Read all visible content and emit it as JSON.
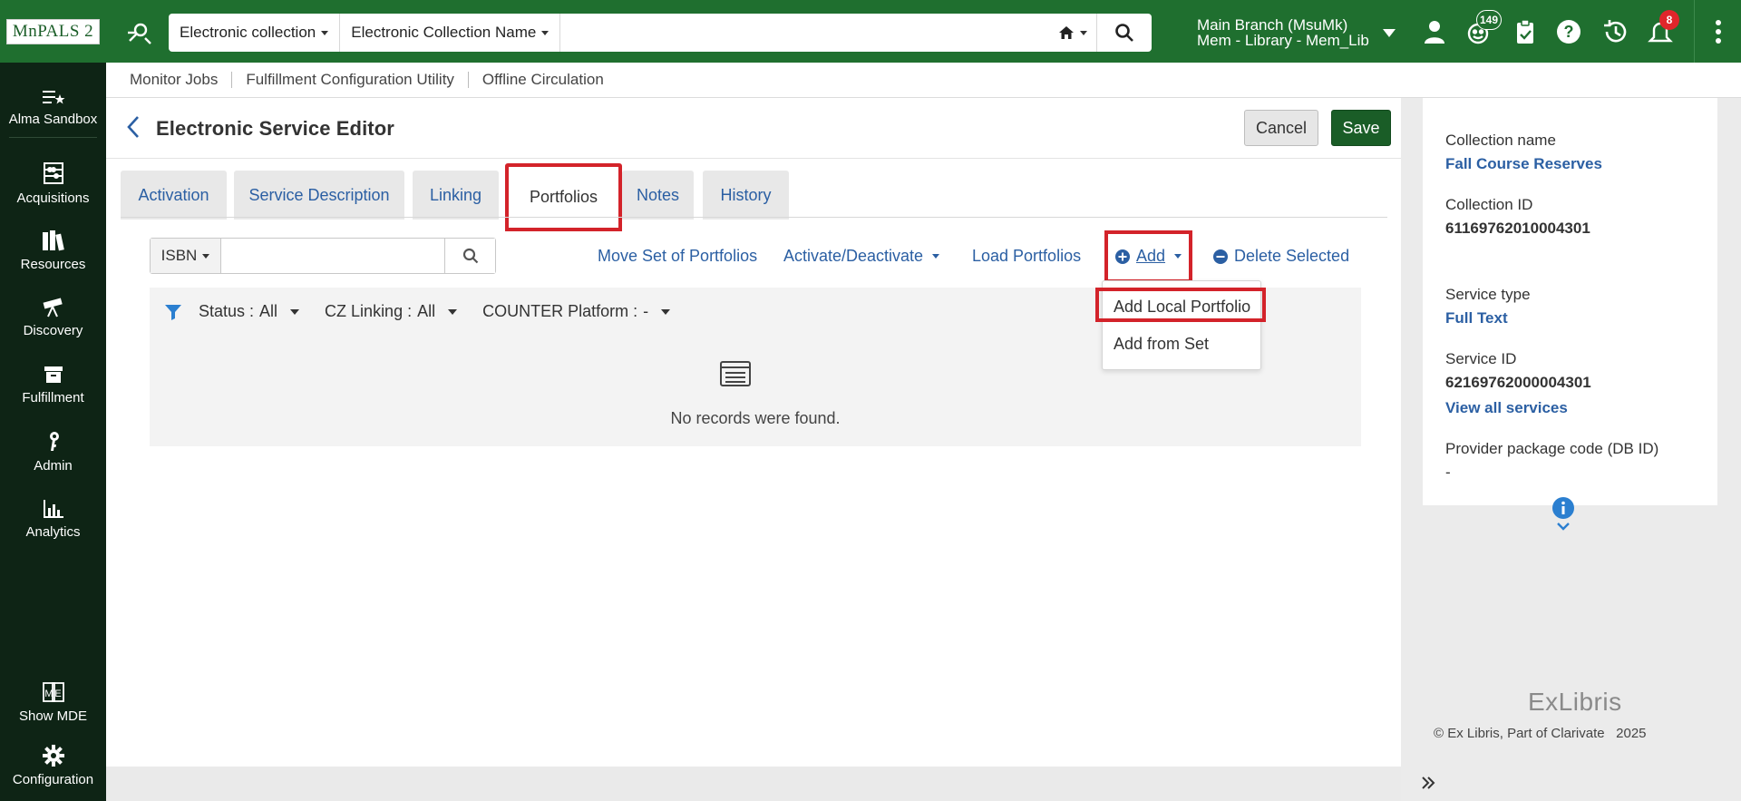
{
  "topbar": {
    "logo": "MnPALS 2",
    "search": {
      "scope": "Electronic collection",
      "field": "Electronic Collection Name",
      "placeholder": ""
    },
    "branch_line1": "Main Branch (MsuMk)",
    "branch_line2": "Mem - Library - Mem_Lib",
    "tasks_badge": "149",
    "notifications_badge": "8"
  },
  "leftnav": {
    "items": [
      {
        "label": "Alma Sandbox",
        "icon": "list-star-icon"
      },
      {
        "label": "Acquisitions",
        "icon": "abacus-icon"
      },
      {
        "label": "Resources",
        "icon": "books-icon"
      },
      {
        "label": "Discovery",
        "icon": "telescope-icon"
      },
      {
        "label": "Fulfillment",
        "icon": "archive-box-icon"
      },
      {
        "label": "Admin",
        "icon": "key-icon"
      },
      {
        "label": "Analytics",
        "icon": "bar-chart-icon"
      },
      {
        "label": "Show MDE",
        "icon": "mde-icon"
      },
      {
        "label": "Configuration",
        "icon": "gear-icon"
      }
    ]
  },
  "subbar": {
    "links": [
      "Monitor Jobs",
      "Fulfillment Configuration Utility",
      "Offline Circulation"
    ]
  },
  "page": {
    "title": "Electronic Service Editor",
    "cancel": "Cancel",
    "save": "Save",
    "tabs": [
      "Activation",
      "Service Description",
      "Linking",
      "Portfolios",
      "Notes",
      "History"
    ],
    "active_tab": "Portfolios"
  },
  "toolbar": {
    "search_field": "ISBN",
    "search_value": "",
    "move_set": "Move Set of Portfolios",
    "activate": "Activate/Deactivate",
    "load": "Load Portfolios",
    "add": "Add",
    "delete": "Delete Selected"
  },
  "add_menu": {
    "items": [
      "Add Local Portfolio",
      "Add from Set"
    ]
  },
  "filters": {
    "status_label": "Status :",
    "status_value": "All",
    "cz_label": "CZ Linking :",
    "cz_value": "All",
    "counter_label": "COUNTER Platform :",
    "counter_value": "-"
  },
  "empty": {
    "message": "No records were found."
  },
  "info": {
    "collection_name_label": "Collection name",
    "collection_name": "Fall Course Reserves",
    "collection_id_label": "Collection ID",
    "collection_id": "61169762010004301",
    "service_type_label": "Service type",
    "service_type": "Full Text",
    "service_id_label": "Service ID",
    "service_id": "62169762000004301",
    "view_all": "View all services",
    "provider_label": "Provider package code (DB ID)",
    "provider_value": "-"
  },
  "footer": {
    "brand": "ExLibris",
    "copyright": "© Ex Libris, Part of Clarivate",
    "year": "2025"
  },
  "colors": {
    "brand_green": "#1f6f2f",
    "nav_dark": "#0e2415",
    "link_blue": "#2b5fa3",
    "highlight_red": "#d3232a"
  }
}
